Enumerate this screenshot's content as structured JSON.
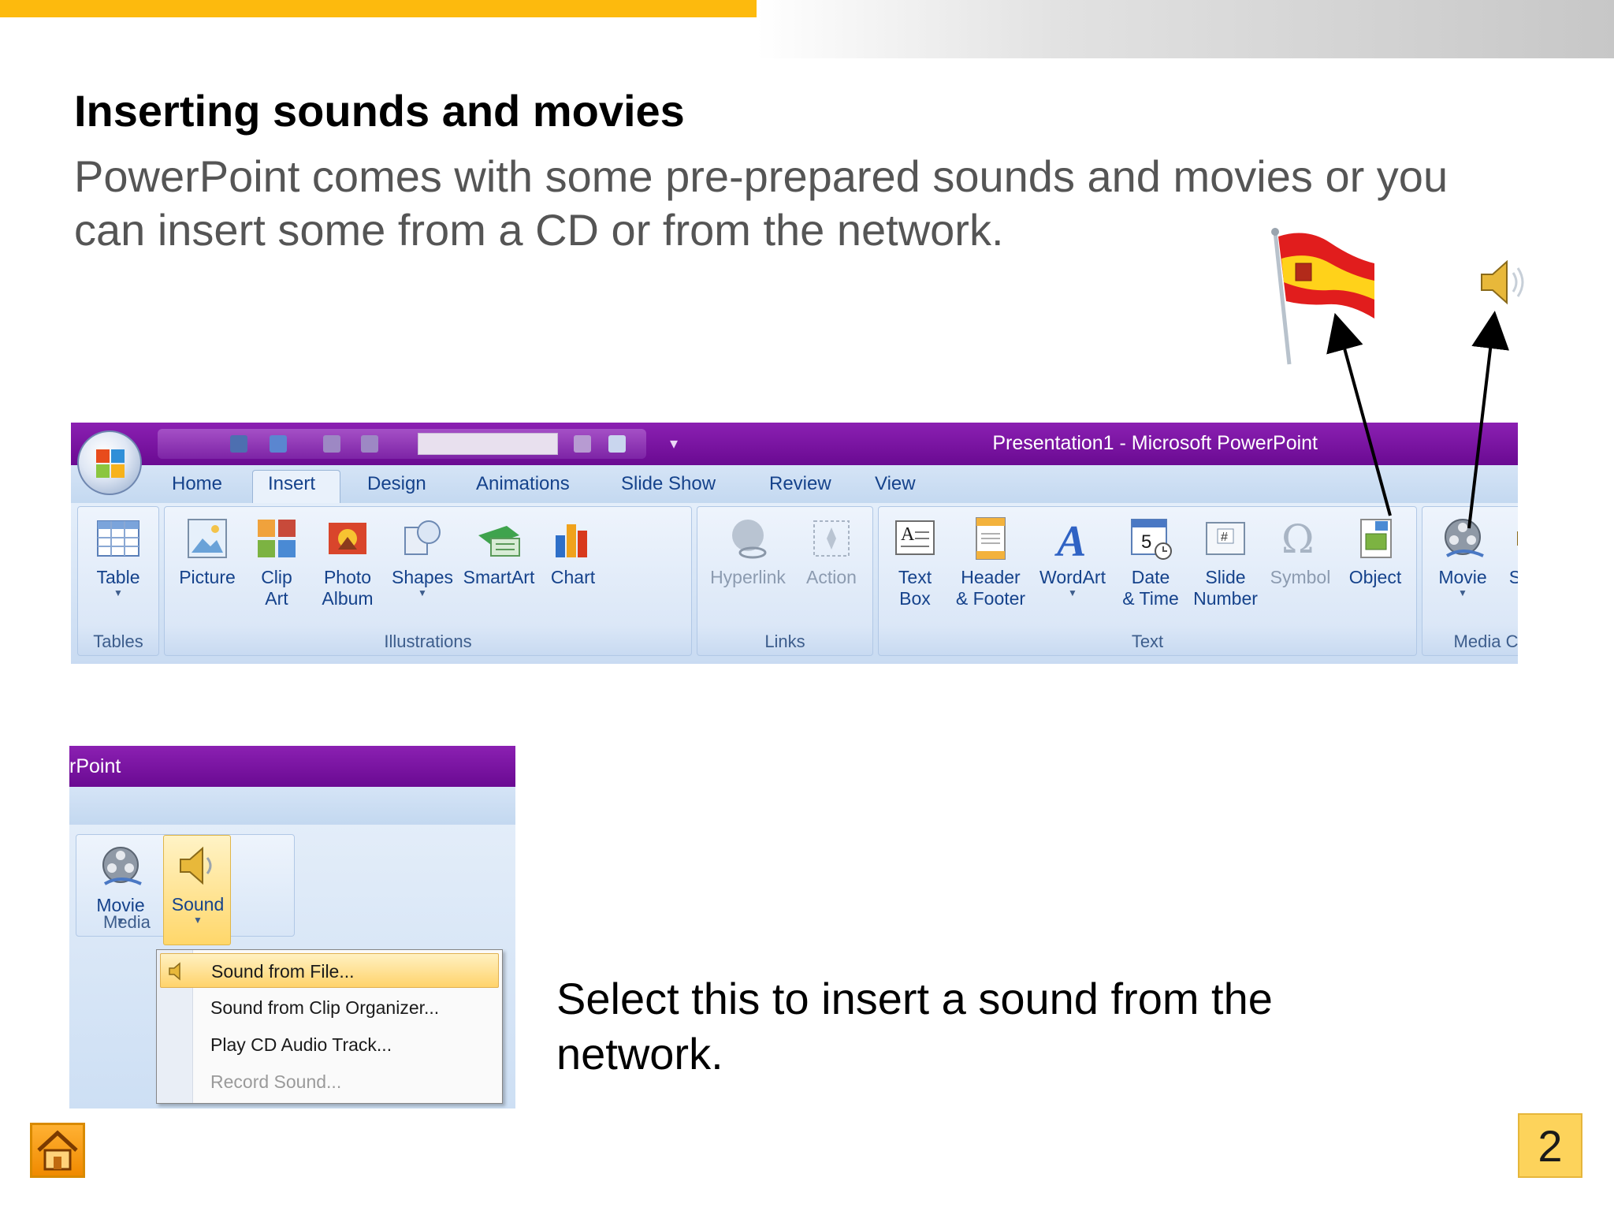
{
  "slide": {
    "title": "Inserting sounds and movies",
    "body": "PowerPoint comes with some pre-prepared sounds and movies or you can insert some from a CD or from the network.",
    "caption": "Select this to insert a sound from the network.",
    "page_number": "2"
  },
  "ribbon": {
    "window_title": "Presentation1 - Microsoft PowerPoint",
    "tabs": [
      "Home",
      "Insert",
      "Design",
      "Animations",
      "Slide Show",
      "Review",
      "View"
    ],
    "active_tab": "Insert",
    "groups": {
      "tables": {
        "label": "Tables",
        "buttons": {
          "table": "Table"
        }
      },
      "illustrations": {
        "label": "Illustrations",
        "buttons": {
          "picture": "Picture",
          "clip_art": "Clip\nArt",
          "photo_album": "Photo\nAlbum",
          "shapes": "Shapes",
          "smartart": "SmartArt",
          "chart": "Chart"
        }
      },
      "links": {
        "label": "Links",
        "buttons": {
          "hyperlink": "Hyperlink",
          "action": "Action"
        }
      },
      "text": {
        "label": "Text",
        "buttons": {
          "text_box": "Text\nBox",
          "header_footer": "Header\n& Footer",
          "wordart": "WordArt",
          "date_time": "Date\n& Time",
          "slide_number": "Slide\nNumber",
          "symbol": "Symbol",
          "object": "Object"
        }
      },
      "media_clips": {
        "label": "Media Clips",
        "buttons": {
          "movie": "Movie",
          "sound": "Sound"
        }
      }
    }
  },
  "menu_screenshot": {
    "title_fragment": "rPoint",
    "group_label_fragment": "Media",
    "buttons": {
      "movie": "Movie",
      "sound": "Sound"
    },
    "menu_items": [
      {
        "label": "Sound from File...",
        "state": "highlighted"
      },
      {
        "label": "Sound from Clip Organizer...",
        "state": "normal"
      },
      {
        "label": "Play CD Audio Track...",
        "state": "normal"
      },
      {
        "label": "Record Sound...",
        "state": "disabled"
      }
    ]
  },
  "icons": {
    "flag": "spain-flag-icon",
    "speaker": "speaker-icon",
    "home": "home-icon"
  },
  "colors": {
    "accent_yellow": "#FDBA0D",
    "titlebar_purple": "#7a12a6",
    "ribbon_blue": "#c5d9f1",
    "tab_text": "#15428b"
  }
}
